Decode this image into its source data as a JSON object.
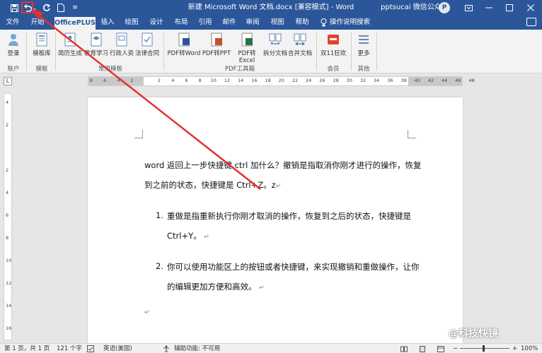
{
  "title_bar": {
    "doc_title": "新建 Microsoft Word 文档.docx [兼容模式] - Word",
    "user_name": "pptsucai 微信公众号",
    "avatar_letter": "P",
    "qat_customize_label": "⌄"
  },
  "tabs": [
    {
      "label": "文件"
    },
    {
      "label": "开始"
    },
    {
      "label": "OfficePLUS"
    },
    {
      "label": "插入"
    },
    {
      "label": "绘图"
    },
    {
      "label": "设计"
    },
    {
      "label": "布局"
    },
    {
      "label": "引用"
    },
    {
      "label": "邮件"
    },
    {
      "label": "审阅"
    },
    {
      "label": "视图"
    },
    {
      "label": "帮助"
    }
  ],
  "tell_me": "操作说明搜索",
  "ribbon": {
    "buttons": {
      "login": "登录",
      "template_lib": "模板库",
      "resume": "简历生成",
      "edu": "教育学习",
      "admin": "行政人资",
      "legal": "法律合同",
      "pdf_word": "PDF转Word",
      "pdf_ppt": "PDF转PPT",
      "pdf_excel": "PDF转Excel",
      "split": "拆分文档",
      "merge": "合并文档",
      "promo": "双11狂欢",
      "more": "更多"
    },
    "groups": {
      "account": "账户",
      "template": "模板",
      "common_template": "常用模板",
      "pdf_tools": "PDF工具箱",
      "member": "会员",
      "other": "其他"
    }
  },
  "ruler": {
    "ticks": [
      "8",
      "6",
      "4",
      "2",
      "",
      "2",
      "4",
      "6",
      "8",
      "10",
      "12",
      "14",
      "16",
      "18",
      "20",
      "22",
      "24",
      "26",
      "28",
      "30",
      "32",
      "34",
      "36",
      "38",
      "40",
      "42",
      "44",
      "46",
      "48"
    ],
    "vticks": [
      "4",
      "2",
      "",
      "2",
      "4",
      "6",
      "8",
      "10",
      "12",
      "14",
      "16"
    ]
  },
  "document": {
    "para1_line1": "word 返回上一步快捷键 ctrl 加什么？撤销是指取消你刚才进行的操作，恢复",
    "para1_line2": "到之前的状态，快捷键是 Ctrl+Z。z",
    "item1_num": "1.",
    "item1_line1": "重做是指重新执行你刚才取消的操作，恢复到之后的状态，快捷键是",
    "item1_line2": "Ctrl+Y。",
    "item2_num": "2.",
    "item2_line1": "你可以使用功能区上的按钮或者快捷键，来实现撤销和重做操作，让你",
    "item2_line2": "的编辑更加方便和高效。",
    "para_mark": "↵"
  },
  "status": {
    "page": "第 1 页，共 1 页",
    "words": "121 个字",
    "lang": "英语(美国)",
    "access": "辅助功能: 不可用",
    "zoom": "100%"
  },
  "watermark": "@科技快镜",
  "colors": {
    "accent": "#2b579a",
    "annotation": "#e53030"
  }
}
